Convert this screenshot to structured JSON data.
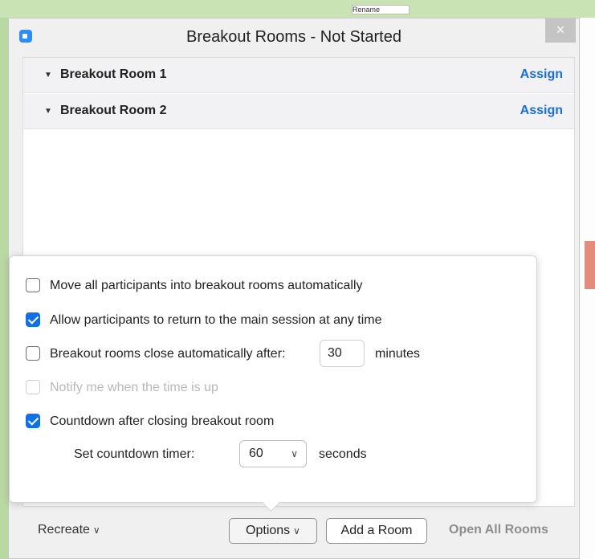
{
  "window": {
    "title": "Breakout Rooms - Not Started",
    "close_glyph": "×"
  },
  "rooms": [
    {
      "name": "Breakout Room 1",
      "assign_label": "Assign",
      "caret": "▼"
    },
    {
      "name": "Breakout Room 2",
      "assign_label": "Assign",
      "caret": "▼"
    }
  ],
  "options": {
    "move_auto": {
      "label": "Move all participants into breakout rooms automatically",
      "checked": false
    },
    "allow_return": {
      "label": "Allow participants to return to the main session at any time",
      "checked": true
    },
    "close_auto": {
      "label": "Breakout rooms close automatically after:",
      "checked": false,
      "value": "30",
      "unit": "minutes"
    },
    "notify": {
      "label": "Notify me when the time is up",
      "checked": false,
      "disabled": true
    },
    "countdown": {
      "label": "Countdown after closing breakout room",
      "checked": true
    },
    "timer": {
      "label": "Set countdown timer:",
      "value": "60",
      "unit": "seconds"
    }
  },
  "bottom_bar": {
    "recreate_label": "Recreate",
    "options_label": "Options",
    "add_room_label": "Add a Room",
    "open_all_label": "Open All Rooms",
    "chevron": "∨"
  },
  "background": {
    "other_window_text": "Rename"
  },
  "colors": {
    "accent": "#0e71eb",
    "link": "#1a6ed8",
    "app_icon": "#2d8cff"
  }
}
